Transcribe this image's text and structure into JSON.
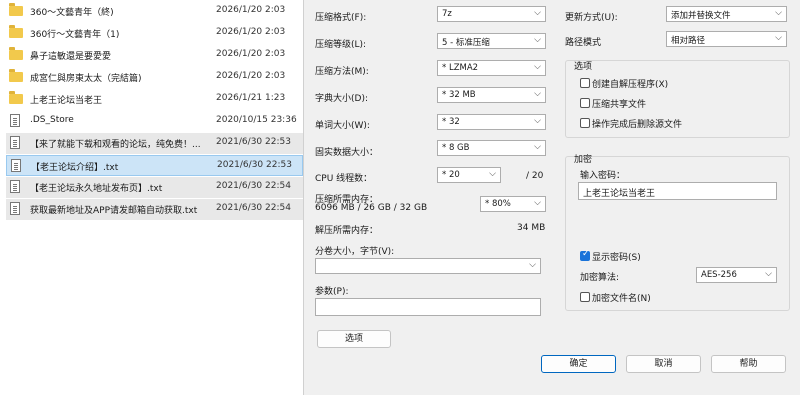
{
  "files": [
    {
      "name": "360～文藝青年（終)",
      "date": "2026/1/20 2:03",
      "type": "folder"
    },
    {
      "name": "360行～文藝青年（1)",
      "date": "2026/1/20 2:03",
      "type": "folder"
    },
    {
      "name": "鼻子這敏還是要愛愛",
      "date": "2026/1/20 2:03",
      "type": "folder"
    },
    {
      "name": "成宮仁與房東太太（完結篇)",
      "date": "2026/1/20 2:03",
      "type": "folder"
    },
    {
      "name": "上老王论坛当老王",
      "date": "2026/1/21 1:23",
      "type": "folder"
    },
    {
      "name": ".DS_Store",
      "date": "2020/10/15 23:36",
      "type": "file"
    },
    {
      "name": "【来了就能下载和观看的论坛，纯免费！...",
      "date": "2021/6/30 22:53",
      "type": "file"
    },
    {
      "name": "【老王论坛介绍】.txt",
      "date": "2021/6/30 22:53",
      "type": "file"
    },
    {
      "name": "【老王论坛永久地址发布页】.txt",
      "date": "2021/6/30 22:54",
      "type": "file"
    },
    {
      "name": "获取最新地址及APP请发邮箱自动获取.txt",
      "date": "2021/6/30 22:54",
      "type": "file"
    }
  ],
  "dialog": {
    "format_label": "压缩格式(F):",
    "format_value": "7z",
    "level_label": "压缩等级(L):",
    "level_value": "5 - 标准压缩",
    "method_label": "压缩方法(M):",
    "method_value": "* LZMA2",
    "dict_label": "字典大小(D):",
    "dict_value": "* 32 MB",
    "word_label": "单词大小(W):",
    "word_value": "* 32",
    "solid_label": "固实数据大小：",
    "solid_value": "* 8 GB",
    "cpu_label": "CPU 线程数：",
    "cpu_value": "* 20",
    "cpu_total": "/ 20",
    "mem_comp_label": "压缩所需内存：",
    "mem_comp_detail": "6096 MB / 26 GB / 32 GB",
    "mem_percent": "* 80%",
    "mem_decomp_label": "解压所需内存：",
    "mem_decomp_value": "34 MB",
    "split_label": "分卷大小，字节(V):",
    "split_value": "",
    "params_label": "参数(P):",
    "params_value": "",
    "options_button": "选项",
    "update_label": "更新方式(U):",
    "update_value": "添加并替换文件",
    "path_label": "路径模式",
    "path_value": "相对路径",
    "options_group": "选项",
    "opt_sfx": "创建自解压程序(X)",
    "opt_sfx_checked": false,
    "opt_shared": "压缩共享文件",
    "opt_shared_checked": false,
    "opt_delete": "操作完成后删除源文件",
    "opt_delete_checked": false,
    "encrypt_group": "加密",
    "password_label": "输入密码：",
    "password_value": "上老王论坛当老王",
    "show_password": "显示密码(S)",
    "show_password_checked": true,
    "enc_method_label": "加密算法:",
    "enc_method_value": "AES-256",
    "enc_names": "加密文件名(N)",
    "enc_names_checked": false,
    "ok": "确定",
    "cancel": "取消",
    "help": "帮助"
  }
}
